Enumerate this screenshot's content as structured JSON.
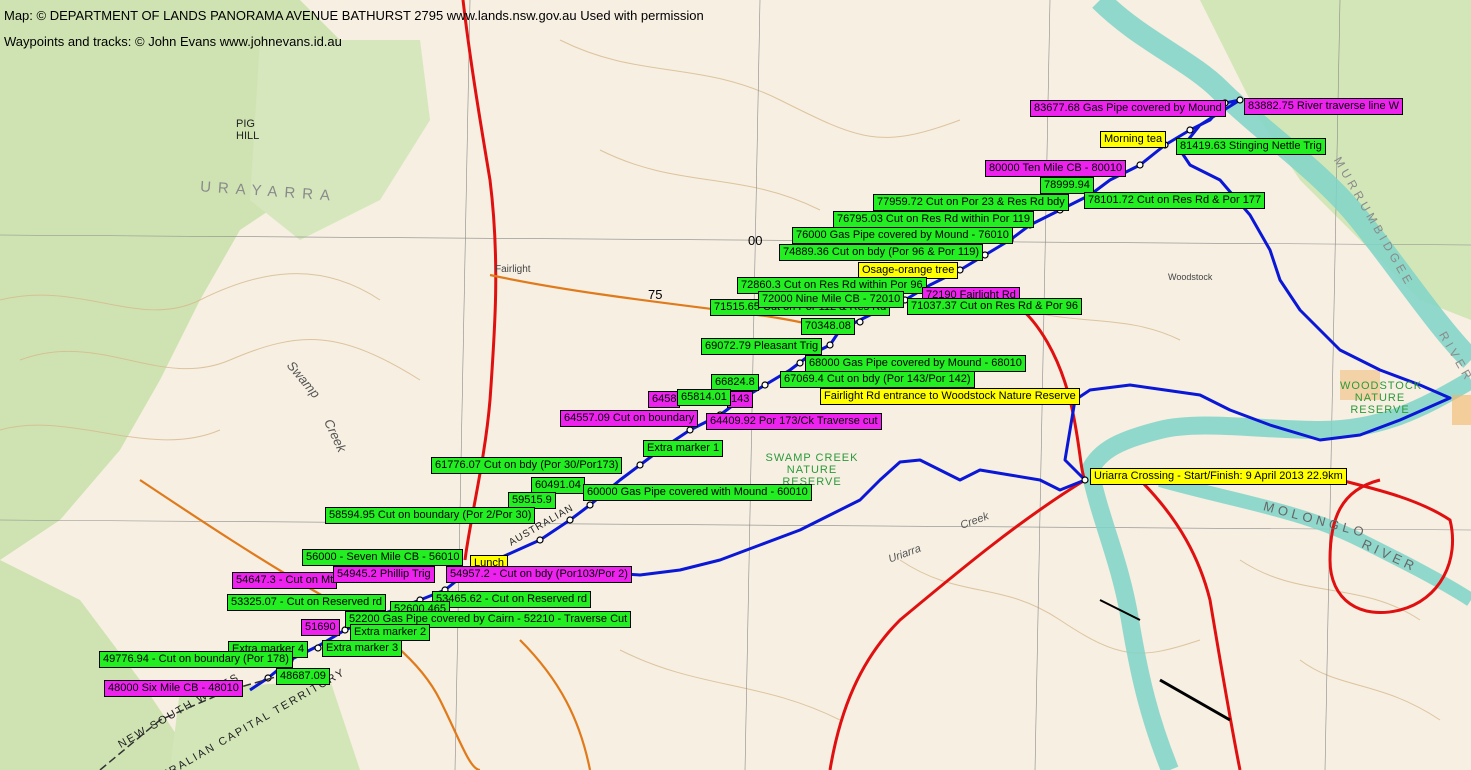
{
  "credits": {
    "map": "Map: © DEPARTMENT OF LANDS PANORAMA AVENUE BATHURST 2795 www.lands.nsw.gov.au  Used with permission",
    "tracks": "Waypoints and tracks: © John Evans www.johnevans.id.au"
  },
  "colors": {
    "track": "#0a17d6",
    "waypoint_green": "#22ee22",
    "waypoint_magenta": "#ee22ee",
    "waypoint_yellow": "#ffff00",
    "road_red": "#e01010",
    "road_orange": "#e07a1a",
    "river": "#7fd3c8",
    "vegetation": "#cfe3b2"
  },
  "map_labels": {
    "urayarra": "URAYARRA",
    "pig_hill": "PIG HILL",
    "swamp": "Swamp",
    "creek": "Creek",
    "fairlight": "Fairlight",
    "grid_00": "00",
    "grid_75": "75",
    "murrumbidgee": "MURRUMBIDGEE",
    "river": "RIVER",
    "woodstock": "Woodstock",
    "woodstock_reserve": "WOODSTOCK NATURE RESERVE",
    "swamp_creek_reserve": "SWAMP CREEK NATURE RESERVE",
    "molonglo": "MOLONGLO",
    "molonglo_river": "RIVER",
    "uriarra": "Uriarra",
    "uriarra_creek": "Creek",
    "nsw": "NEW SOUTH WALES",
    "act": "AUSTRALIAN CAPITAL TERRITORY",
    "australian": "AUSTRALIAN"
  },
  "waypoints": {
    "w83677": "83677.68 Gas Pipe covered by Mound",
    "w83882": "83882.75 River traverse line W",
    "w_morning_tea": "Morning tea",
    "w81419": "81419.63 Stinging Nettle Trig",
    "w80000": "80000 Ten Mile CB - 80010",
    "w78999": "78999.94",
    "w77959": "77959.72 Cut on Por 23 & Res Rd bdy",
    "w78101": "78101.72 Cut on Res Rd & Por 177",
    "w76795": "76795.03 Cut on Res Rd within Por 119",
    "w76000": "76000 Gas Pipe covered by Mound - 76010",
    "w74889": "74889.36 Cut on bdy (Por 96 & Por 119)",
    "w_osage": "Osage-orange tree",
    "w72860": "72860.3 Cut on Res Rd within Por 96",
    "w72190": "72190 Fairlight Rd",
    "w72000": "72000 Nine Mile CB - 72010",
    "w71515": "71515.65 Cut on Por 112 & Res Rd",
    "w71_cut": "71037.37 Cut on Res Rd & Por 96",
    "w70348": "70348.08",
    "w69072": "69072.79 Pleasant Trig",
    "w68000": "68000 Gas Pipe covered by Mound - 68010",
    "w67069": "67069.4 Cut on bdy (Por 143/Por 142)",
    "w66824": "66824.8",
    "w65814": "65814.01",
    "w6458": "6458",
    "w_143": "143",
    "w_fairlight_entrance": "Fairlight Rd entrance to Woodstock Nature Reserve",
    "w64557": "64557.09 Cut on boundary",
    "w64409": "64409.92 Por 173/Ck Traverse cut",
    "w_extra1": "Extra marker 1",
    "w61776": "61776.07 Cut on bdy (Por 30/Por173)",
    "w60491": "60491.04",
    "w59515": "59515.9",
    "w60000": "60000 Gas Pipe covered with Mound - 60010",
    "w58594": "58594.95 Cut on boundary (Por 2/Por 30)",
    "w_start": "Uriarra Crossing - Start/Finish: 9 April 2013 22.9km",
    "w56000": "56000 - Seven Mile CB - 56010",
    "w_lunch": "Lunch",
    "w54647": "54647.3 - Cut on Mt",
    "w54945": "54945.2 Phillip Trig",
    "w54957": "54957.2 - Cut on bdy (Por103/Por 2)",
    "w53325": "53325.07 - Cut on Reserved rd",
    "w53465": "53465.62 - Cut on Reserved rd",
    "w52600": "52600.465",
    "w52200": "52200 Gas Pipe covered by Cairn - 52210 - Traverse Cut",
    "w51690": "51690",
    "w_extra2": "Extra marker 2",
    "w_extra3": "Extra marker 3",
    "w_extra4": "Extra marker 4",
    "w49776": "49776.94 - Cut on boundary (Por 178)",
    "w48687": "48687.09",
    "w48000": "48000 Six Mile CB - 48010"
  }
}
